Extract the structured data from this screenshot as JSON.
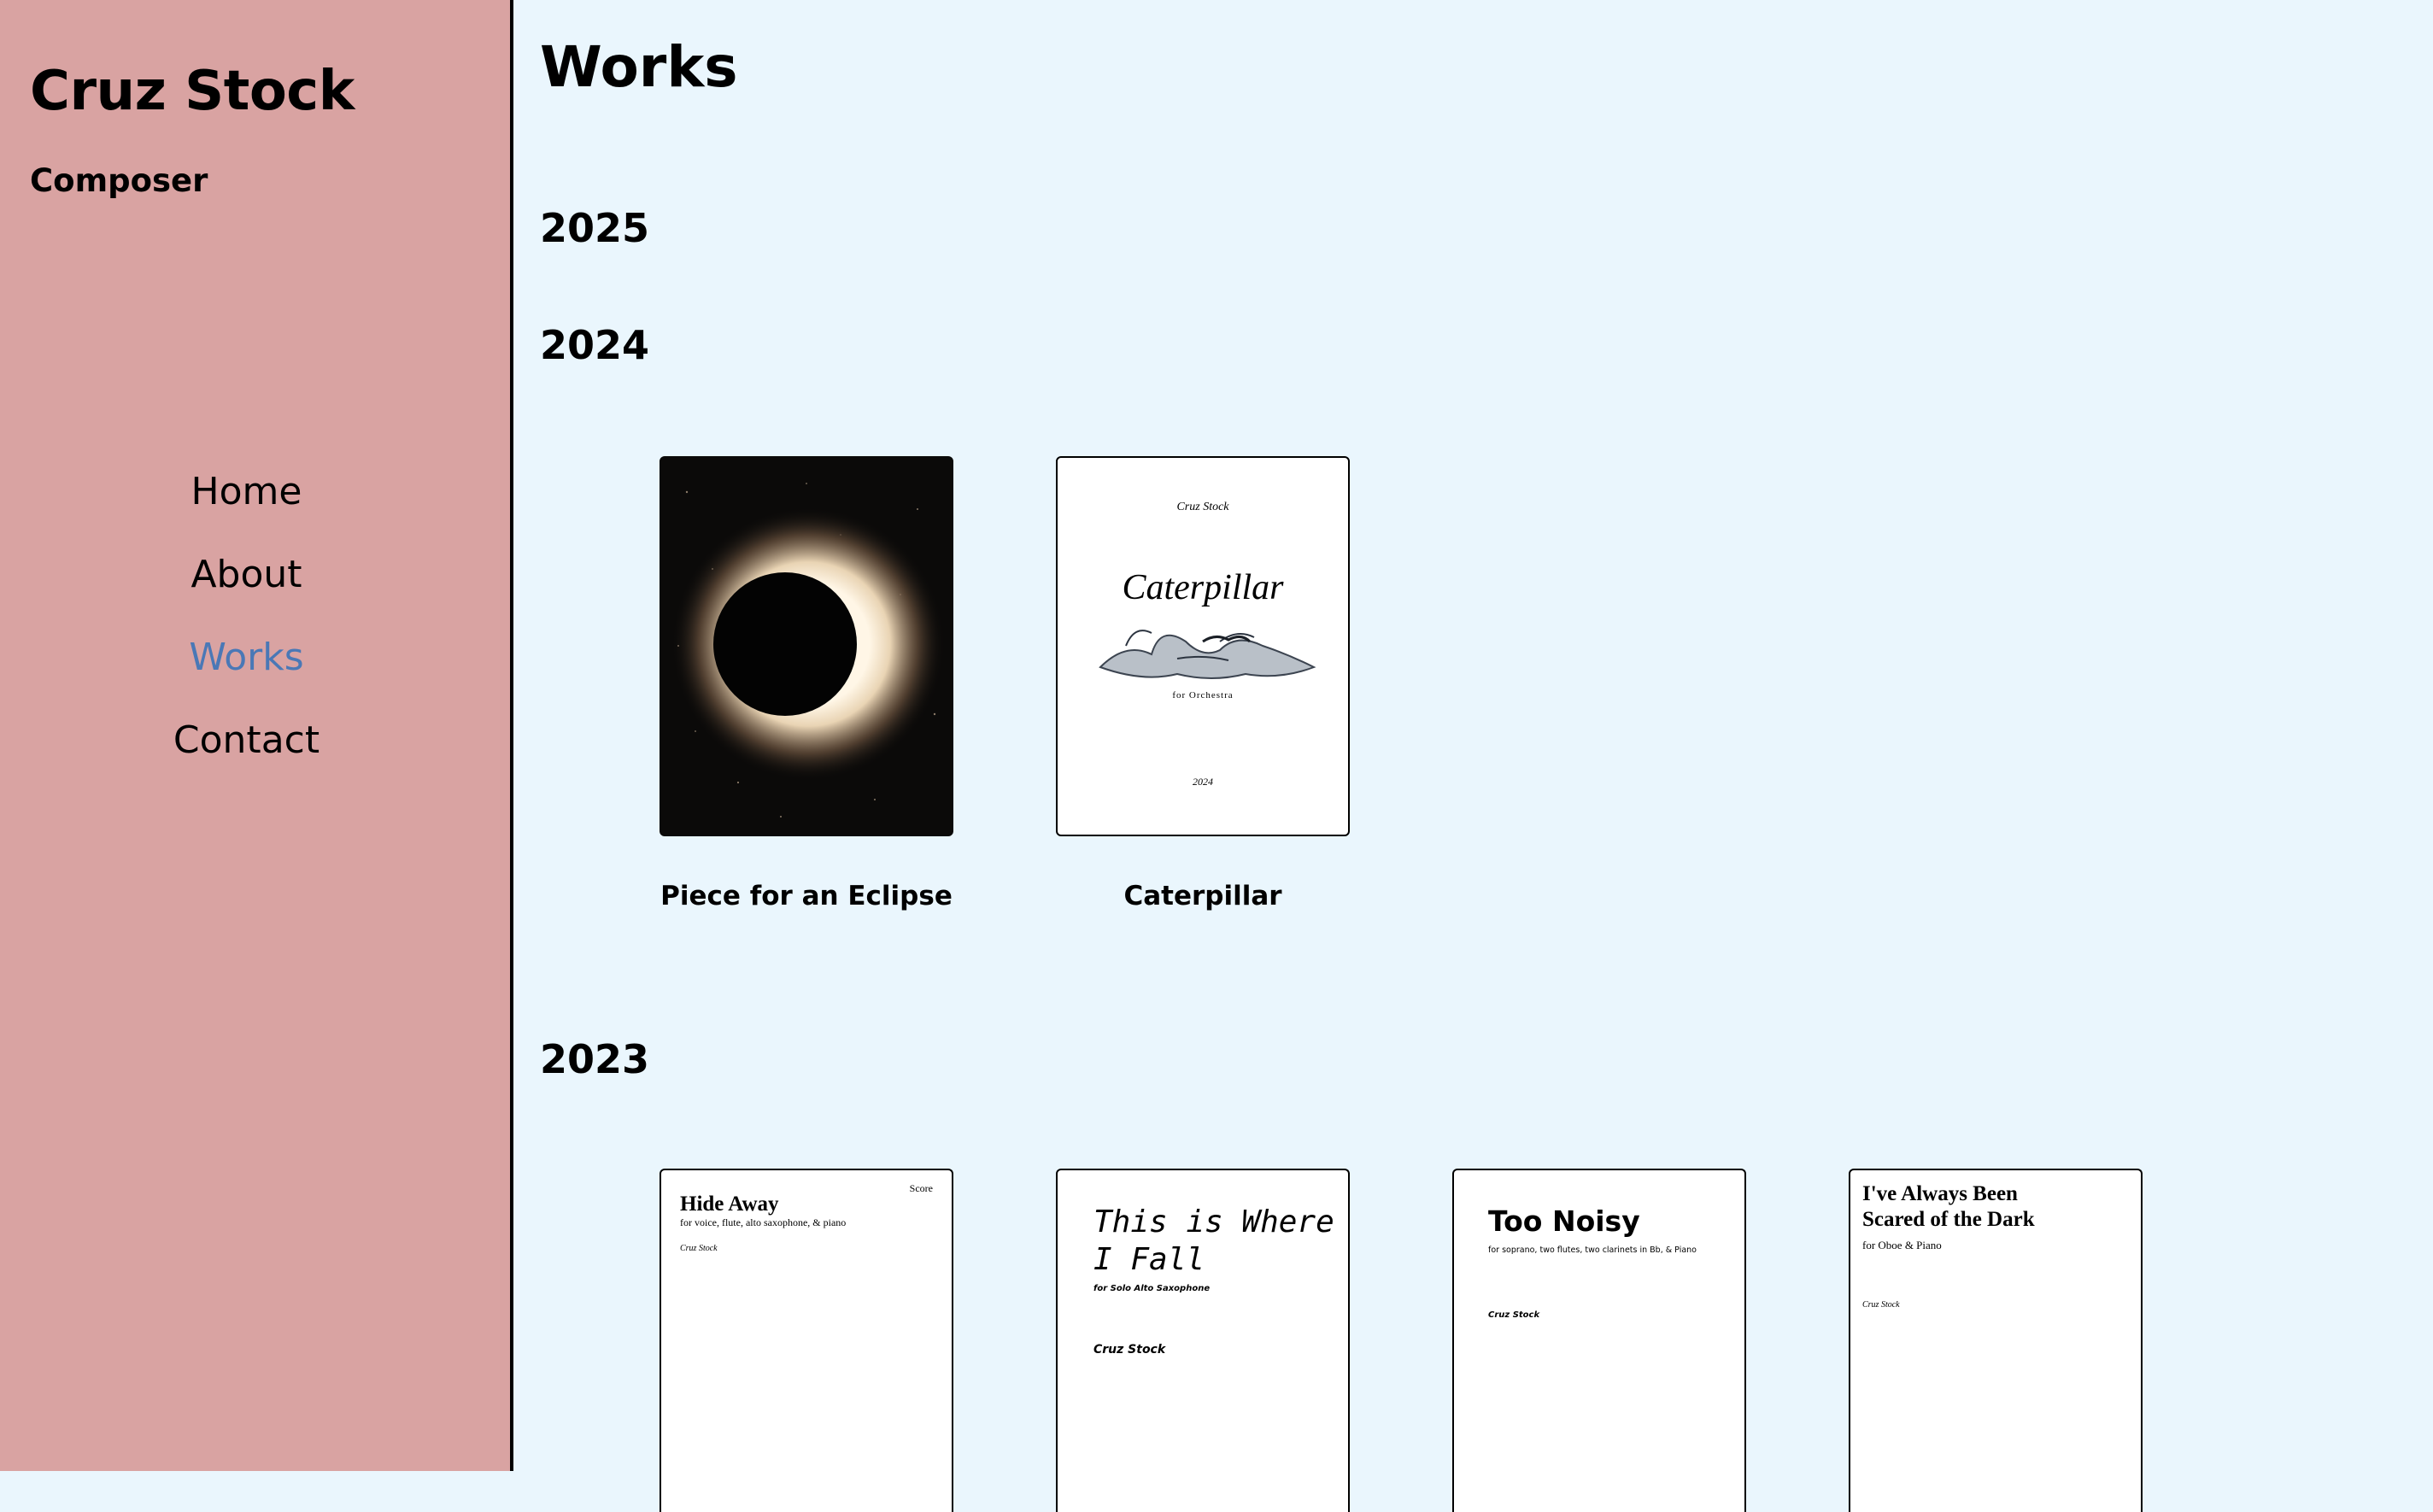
{
  "sidebar": {
    "name": "Cruz Stock",
    "role": "Composer",
    "nav": [
      "Home",
      "About",
      "Works",
      "Contact"
    ],
    "active_nav": "Works",
    "accent_color": "#4a78b6",
    "background_color": "#d9a3a2"
  },
  "main": {
    "title": "Works",
    "background_color": "#eaf6fd",
    "years": [
      "2025",
      "2024",
      "2023"
    ],
    "works_2024": [
      {
        "title": "Piece for an Eclipse",
        "cover": "eclipse-image"
      },
      {
        "title": "Caterpillar",
        "cover_composer": "Cruz Stock",
        "cover_title": "Caterpillar",
        "cover_subtitle": "for Orchestra",
        "cover_year": "2024"
      }
    ],
    "works_2023": [
      {
        "cover_title": "Hide Away",
        "cover_subtitle": "for voice, flute, alto saxophone, & piano",
        "cover_composer": "Cruz Stock",
        "cover_tag": "Score"
      },
      {
        "cover_title_line1": "This is Where",
        "cover_title_line2": "I Fall",
        "cover_subtitle": "for Solo Alto Saxophone",
        "cover_composer": "Cruz Stock"
      },
      {
        "cover_title": "Too Noisy",
        "cover_subtitle": "for soprano, two flutes, two clarinets in Bb, & Piano",
        "cover_composer": "Cruz Stock"
      },
      {
        "cover_title_line1": "I've Always Been",
        "cover_title_line2": "Scared of the Dark",
        "cover_subtitle": "for Oboe & Piano",
        "cover_composer": "Cruz Stock"
      }
    ]
  }
}
